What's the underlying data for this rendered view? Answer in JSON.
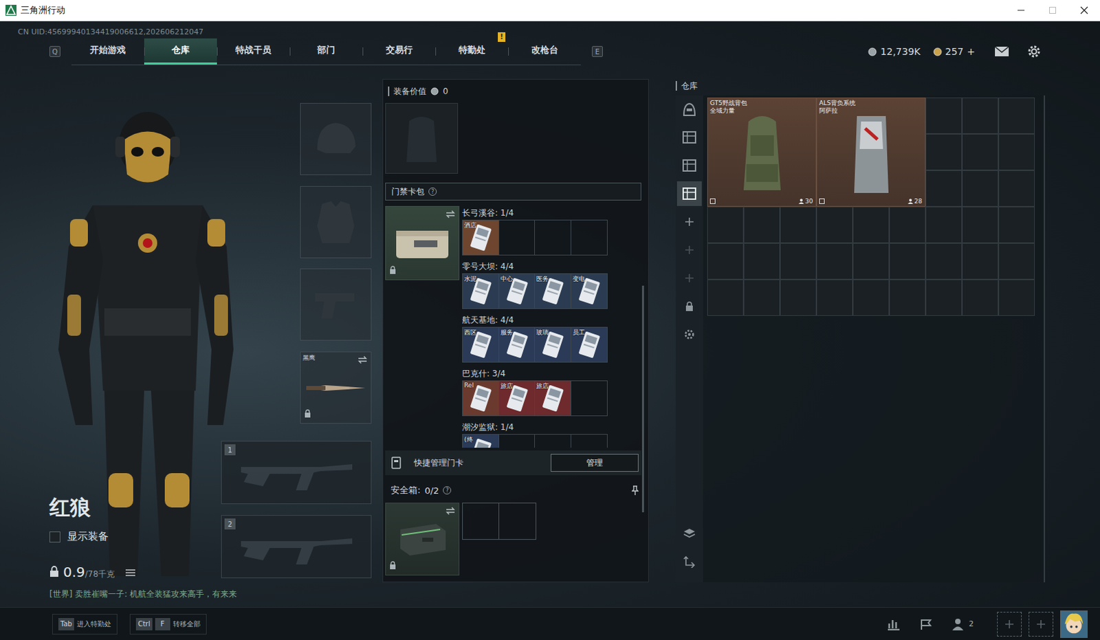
{
  "window": {
    "title": "三角洲行动"
  },
  "uid": "CN UID:45699940134419006612,202606212047",
  "nav": {
    "left_key": "Q",
    "right_key": "E",
    "tabs": [
      {
        "label": "开始游戏",
        "selected": false
      },
      {
        "label": "仓库",
        "selected": true
      },
      {
        "label": "特战干员",
        "selected": false
      },
      {
        "label": "部门",
        "selected": false
      },
      {
        "label": "交易行",
        "selected": false
      },
      {
        "label": "特勤处",
        "selected": false,
        "badge": "!"
      },
      {
        "label": "改枪台",
        "selected": false
      }
    ]
  },
  "currency": [
    {
      "kind": "silver",
      "amount": "12,739K"
    },
    {
      "kind": "gold",
      "amount": "257",
      "action": "+"
    }
  ],
  "operator": {
    "name": "红狼",
    "show_equipment": {
      "label": "显示装备",
      "checked": false
    },
    "weight": "0.9",
    "weight_max": "/78千克"
  },
  "chat": "[世界] 卖胜崔嘴一子: 机航全装猛攻来高手，有来来",
  "equipment": {
    "slots": [
      {
        "kind": "helmet"
      },
      {
        "kind": "armor"
      },
      {
        "kind": "pistol"
      },
      {
        "kind": "melee",
        "label": "黑鹰",
        "locked": true
      }
    ],
    "weapons": [
      {
        "number": "1"
      },
      {
        "number": "2"
      }
    ]
  },
  "loadout": {
    "value_label": "装备价值",
    "value": "0",
    "keycard_bag": {
      "title": "门禁卡包",
      "help": "?",
      "locked": true,
      "maps": [
        {
          "name": "长弓溪谷: 1/4",
          "cards": [
            {
              "label": "酒店",
              "color": "#6e4630"
            }
          ]
        },
        {
          "name": "零号大坝: 4/4",
          "cards": [
            {
              "label": "水泥",
              "color": "#2b3c52"
            },
            {
              "label": "中心",
              "color": "#2b3c52"
            },
            {
              "label": "医务",
              "color": "#2b3c52"
            },
            {
              "label": "变电",
              "color": "#2b3c52"
            }
          ]
        },
        {
          "name": "航天基地: 4/4",
          "cards": [
            {
              "label": "西区",
              "color": "#2a3a57"
            },
            {
              "label": "服务",
              "color": "#2a3a57"
            },
            {
              "label": "玻璃",
              "color": "#2a3a57"
            },
            {
              "label": "员工",
              "color": "#2a3a57"
            }
          ]
        },
        {
          "name": "巴克什: 3/4",
          "cards": [
            {
              "label": "Rel",
              "color": "#6b3a2e"
            },
            {
              "label": "旅店",
              "color": "#6e2a2c"
            },
            {
              "label": "旅店",
              "color": "#6e2a2c"
            }
          ]
        },
        {
          "name": "潮汐监狱: 1/4",
          "cards": [
            {
              "label": "(终",
              "color": "#2a3a57"
            }
          ]
        }
      ]
    },
    "quick_manage": {
      "label": "快捷管理门卡",
      "button": "管理"
    },
    "safe_box": {
      "label": "安全箱:",
      "count": "0/2",
      "help": "?",
      "locked": true
    }
  },
  "warehouse": {
    "title": "仓库",
    "sidebar": [
      {
        "kind": "operator",
        "selected": false,
        "disabled": false
      },
      {
        "kind": "storage",
        "selected": false,
        "disabled": false
      },
      {
        "kind": "storage",
        "selected": false,
        "disabled": false
      },
      {
        "kind": "storage",
        "selected": true,
        "disabled": false
      },
      {
        "kind": "add",
        "selected": false,
        "disabled": false
      },
      {
        "kind": "add",
        "selected": false,
        "disabled": true
      },
      {
        "kind": "add",
        "selected": false,
        "disabled": true
      },
      {
        "kind": "lock",
        "selected": false,
        "disabled": false
      },
      {
        "kind": "gear",
        "selected": false,
        "disabled": false
      }
    ],
    "sidebar_bottom": [
      {
        "kind": "layers"
      },
      {
        "kind": "transfer"
      }
    ],
    "items": [
      {
        "name": "GT5野战背包",
        "faction": "全域力量",
        "count": "30"
      },
      {
        "name": "ALS背负系统",
        "faction": "阿萨拉",
        "count": "28"
      }
    ]
  },
  "hints": [
    {
      "keys": [
        "Tab"
      ],
      "label": "进入特勤处"
    },
    {
      "keys": [
        "Ctrl",
        "F"
      ],
      "label": "转移全部"
    }
  ],
  "bottom_bar": {
    "friends": "2"
  }
}
